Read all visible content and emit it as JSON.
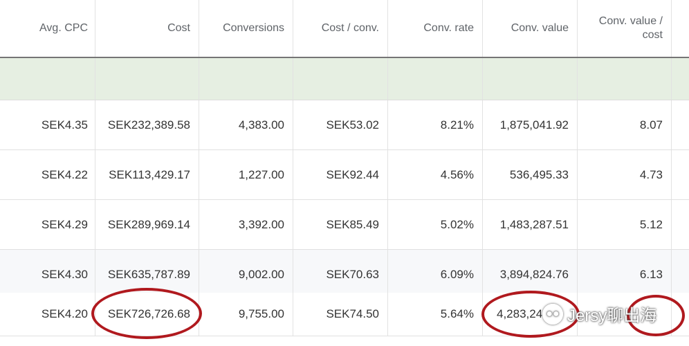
{
  "columns": [
    "Avg. CPC",
    "Cost",
    "Conversions",
    "Cost / conv.",
    "Conv. rate",
    "Conv. value",
    "Conv. value /",
    "cost"
  ],
  "rows": [
    [
      "SEK4.35",
      "SEK232,389.58",
      "4,383.00",
      "SEK53.02",
      "8.21%",
      "1,875,041.92",
      "8.07"
    ],
    [
      "SEK4.22",
      "SEK113,429.17",
      "1,227.00",
      "SEK92.44",
      "4.56%",
      "536,495.33",
      "4.73"
    ],
    [
      "SEK4.29",
      "SEK289,969.14",
      "3,392.00",
      "SEK85.49",
      "5.02%",
      "1,483,287.51",
      "5.12"
    ],
    [
      "SEK4.30",
      "SEK635,787.89",
      "9,002.00",
      "SEK70.63",
      "6.09%",
      "3,894,824.76",
      "6.13"
    ],
    [
      "SEK4.20",
      "SEK726,726.68",
      "9,755.00",
      "SEK74.50",
      "5.64%",
      "4,283,24",
      ""
    ]
  ],
  "watermark": {
    "icon": "wechat-icon",
    "text": "Jersy聊出海"
  },
  "highlight_color": "#b0191e",
  "summary_row_color": "#e6efe2"
}
